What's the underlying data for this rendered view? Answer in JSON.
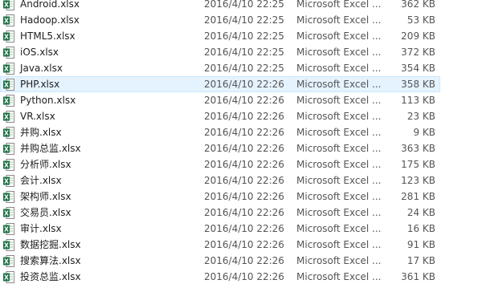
{
  "files": [
    {
      "name": "Android.xlsx",
      "date": "2016/4/10 22:25",
      "type": "Microsoft Excel ...",
      "size": "362 KB",
      "icon": "excel-file-icon"
    },
    {
      "name": "Hadoop.xlsx",
      "date": "2016/4/10 22:25",
      "type": "Microsoft Excel ...",
      "size": "53 KB",
      "icon": "excel-file-icon"
    },
    {
      "name": "HTML5.xlsx",
      "date": "2016/4/10 22:25",
      "type": "Microsoft Excel ...",
      "size": "209 KB",
      "icon": "excel-file-icon"
    },
    {
      "name": "iOS.xlsx",
      "date": "2016/4/10 22:25",
      "type": "Microsoft Excel ...",
      "size": "372 KB",
      "icon": "excel-file-icon"
    },
    {
      "name": "Java.xlsx",
      "date": "2016/4/10 22:25",
      "type": "Microsoft Excel ...",
      "size": "354 KB",
      "icon": "excel-file-icon"
    },
    {
      "name": "PHP.xlsx",
      "date": "2016/4/10 22:26",
      "type": "Microsoft Excel ...",
      "size": "358 KB",
      "icon": "excel-file-icon",
      "selected": true
    },
    {
      "name": "Python.xlsx",
      "date": "2016/4/10 22:26",
      "type": "Microsoft Excel ...",
      "size": "113 KB",
      "icon": "excel-file-icon"
    },
    {
      "name": "VR.xlsx",
      "date": "2016/4/10 22:26",
      "type": "Microsoft Excel ...",
      "size": "23 KB",
      "icon": "excel-file-icon"
    },
    {
      "name": "并购.xlsx",
      "date": "2016/4/10 22:26",
      "type": "Microsoft Excel ...",
      "size": "9 KB",
      "icon": "excel-file-icon"
    },
    {
      "name": "并购总监.xlsx",
      "date": "2016/4/10 22:26",
      "type": "Microsoft Excel ...",
      "size": "363 KB",
      "icon": "excel-file-icon"
    },
    {
      "name": "分析师.xlsx",
      "date": "2016/4/10 22:26",
      "type": "Microsoft Excel ...",
      "size": "175 KB",
      "icon": "excel-file-icon"
    },
    {
      "name": "会计.xlsx",
      "date": "2016/4/10 22:26",
      "type": "Microsoft Excel ...",
      "size": "123 KB",
      "icon": "excel-file-icon"
    },
    {
      "name": "架构师.xlsx",
      "date": "2016/4/10 22:26",
      "type": "Microsoft Excel ...",
      "size": "281 KB",
      "icon": "excel-file-icon"
    },
    {
      "name": "交易员.xlsx",
      "date": "2016/4/10 22:26",
      "type": "Microsoft Excel ...",
      "size": "24 KB",
      "icon": "excel-file-icon"
    },
    {
      "name": "审计.xlsx",
      "date": "2016/4/10 22:26",
      "type": "Microsoft Excel ...",
      "size": "16 KB",
      "icon": "excel-file-icon"
    },
    {
      "name": "数据挖掘.xlsx",
      "date": "2016/4/10 22:26",
      "type": "Microsoft Excel ...",
      "size": "91 KB",
      "icon": "excel-file-icon"
    },
    {
      "name": "搜索算法.xlsx",
      "date": "2016/4/10 22:26",
      "type": "Microsoft Excel ...",
      "size": "17 KB",
      "icon": "excel-file-icon"
    },
    {
      "name": "投资总监.xlsx",
      "date": "2016/4/10 22:26",
      "type": "Microsoft Excel ...",
      "size": "361 KB",
      "icon": "excel-file-icon"
    }
  ],
  "colors": {
    "selection_fill": "#e5f3ff",
    "selection_border": "#cce8ff",
    "excel_green": "#1e7145",
    "secondary_text": "#555555"
  }
}
